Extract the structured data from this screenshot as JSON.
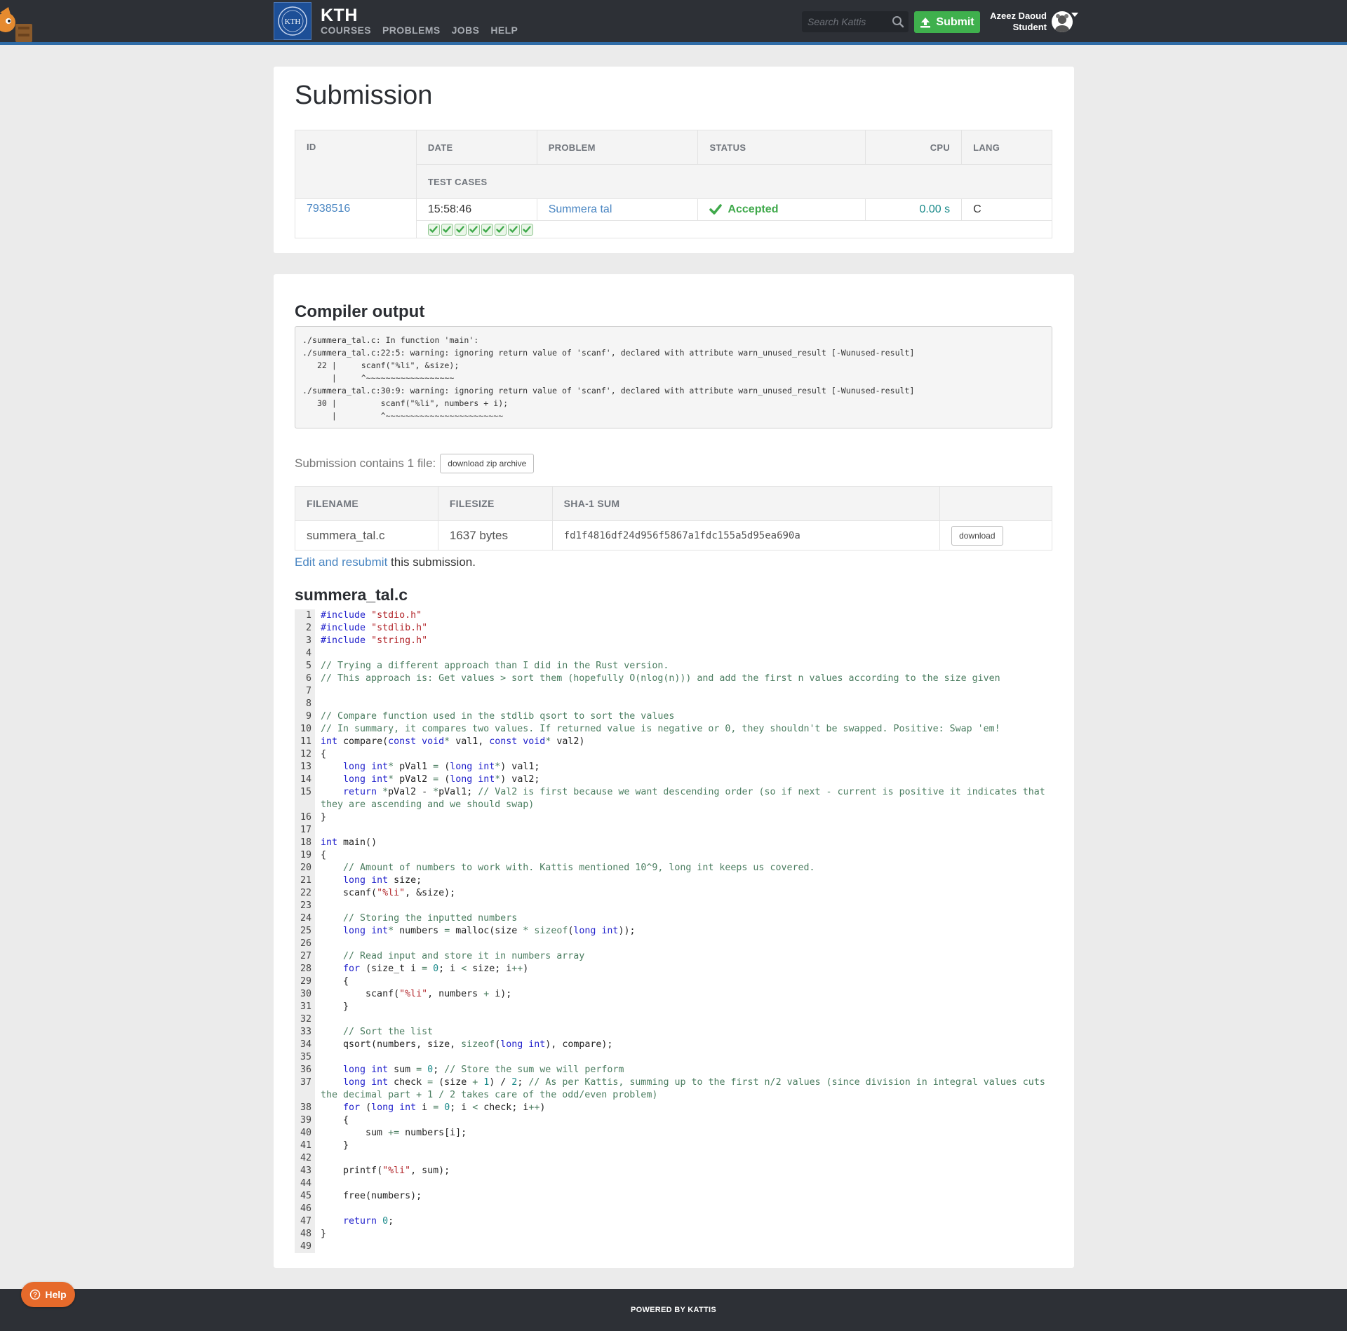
{
  "header": {
    "brand": "KTH",
    "logo_text": "KTH",
    "nav": [
      "COURSES",
      "PROBLEMS",
      "JOBS",
      "HELP"
    ],
    "search_placeholder": "Search Kattis",
    "submit_label": "Submit",
    "user_name": "Azeez Daoud",
    "user_role": "Student"
  },
  "submission": {
    "title": "Submission",
    "columns": [
      "ID",
      "DATE",
      "PROBLEM",
      "STATUS",
      "CPU",
      "LANG"
    ],
    "test_cases_label": "TEST CASES",
    "id": "7938516",
    "date": "15:58:46",
    "problem": "Summera tal",
    "status": "Accepted",
    "cpu": "0.00 s",
    "lang": "C",
    "test_cases_passed": 8
  },
  "compiler": {
    "title": "Compiler output",
    "output": "./summera_tal.c: In function 'main':\n./summera_tal.c:22:5: warning: ignoring return value of 'scanf', declared with attribute warn_unused_result [-Wunused-result]\n   22 |     scanf(\"%li\", &size);\n      |     ^~~~~~~~~~~~~~~~~~~\n./summera_tal.c:30:9: warning: ignoring return value of 'scanf', declared with attribute warn_unused_result [-Wunused-result]\n   30 |         scanf(\"%li\", numbers + i);\n      |         ^~~~~~~~~~~~~~~~~~~~~~~~~"
  },
  "files": {
    "contains_text": "Submission contains 1 file:",
    "zip_label": "download zip archive",
    "columns": [
      "FILENAME",
      "FILESIZE",
      "SHA-1 SUM",
      ""
    ],
    "rows": [
      {
        "filename": "summera_tal.c",
        "size": "1637 bytes",
        "sha1": "fd1f4816df24d956f5867a1fdc155a5d95ea690a",
        "download": "download"
      }
    ],
    "edit_link": "Edit and resubmit",
    "edit_suffix": " this submission."
  },
  "code": {
    "filename": "summera_tal.c",
    "lines": [
      "#include \"stdio.h\"",
      "#include \"stdlib.h\"",
      "#include \"string.h\"",
      "",
      "// Trying a different approach than I did in the Rust version.",
      "// This approach is: Get values > sort them (hopefully O(nlog(n))) and add the first n values according to the size given",
      "",
      "",
      "// Compare function used in the stdlib qsort to sort the values",
      "// In summary, it compares two values. If returned value is negative or 0, they shouldn't be swapped. Positive: Swap 'em!",
      "int compare(const void* val1, const void* val2)",
      "{",
      "    long int* pVal1 = (long int*) val1;",
      "    long int* pVal2 = (long int*) val2;",
      "    return *pVal2 - *pVal1; // Val2 is first because we want descending order (so if next - current is positive it indicates that they are ascending and we should swap)",
      "}",
      "",
      "int main()",
      "{",
      "    // Amount of numbers to work with. Kattis mentioned 10^9, long int keeps us covered.",
      "    long int size;",
      "    scanf(\"%li\", &size);",
      "",
      "    // Storing the inputted numbers",
      "    long int* numbers = malloc(size * sizeof(long int));",
      "",
      "    // Read input and store it in numbers array",
      "    for (size_t i = 0; i < size; i++)",
      "    {",
      "        scanf(\"%li\", numbers + i);",
      "    }",
      "",
      "    // Sort the list",
      "    qsort(numbers, size, sizeof(long int), compare);",
      "",
      "    long int sum = 0; // Store the sum we will perform",
      "    long int check = (size + 1) / 2; // As per Kattis, summing up to the first n/2 values (since division in integral values cuts the decimal part + 1 / 2 takes care of the odd/even problem)",
      "    for (long int i = 0; i < check; i++)",
      "    {",
      "        sum += numbers[i];",
      "    }",
      "",
      "    printf(\"%li\", sum);",
      "",
      "    free(numbers);",
      "",
      "    return 0;",
      "}",
      ""
    ]
  },
  "help_button": "Help",
  "footer": "POWERED BY KATTIS",
  "colors": {
    "topbar": "#2d3036",
    "accent_blue": "#2f6ca7",
    "link": "#4a86c2",
    "accepted": "#3fa94b",
    "submit": "#3fb04d",
    "help": "#e66a2b"
  }
}
